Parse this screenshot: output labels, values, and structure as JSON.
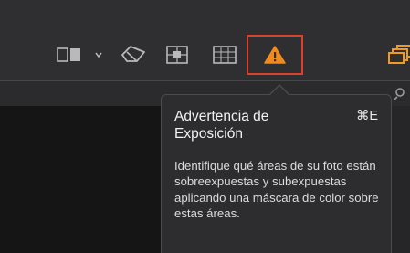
{
  "toolbar": {
    "icons": [
      "compare-view-icon",
      "chevron-down-icon",
      "eraser-icon",
      "grid-overlay-icon",
      "table-grid-icon",
      "exposure-warning-icon",
      "stacked-windows-icon"
    ]
  },
  "tooltip": {
    "title": "Advertencia de Exposición",
    "shortcut": "⌘E",
    "description": "Identifique qué áreas de su foto están sobreexpuestas y subexpuestas aplicando una máscara de color sobre estas áreas."
  },
  "colors": {
    "highlight_border": "#d9432e",
    "warning_fill": "#f08a1c",
    "accent_orange": "#f29a1e",
    "icon_gray": "#b9b9bc"
  }
}
